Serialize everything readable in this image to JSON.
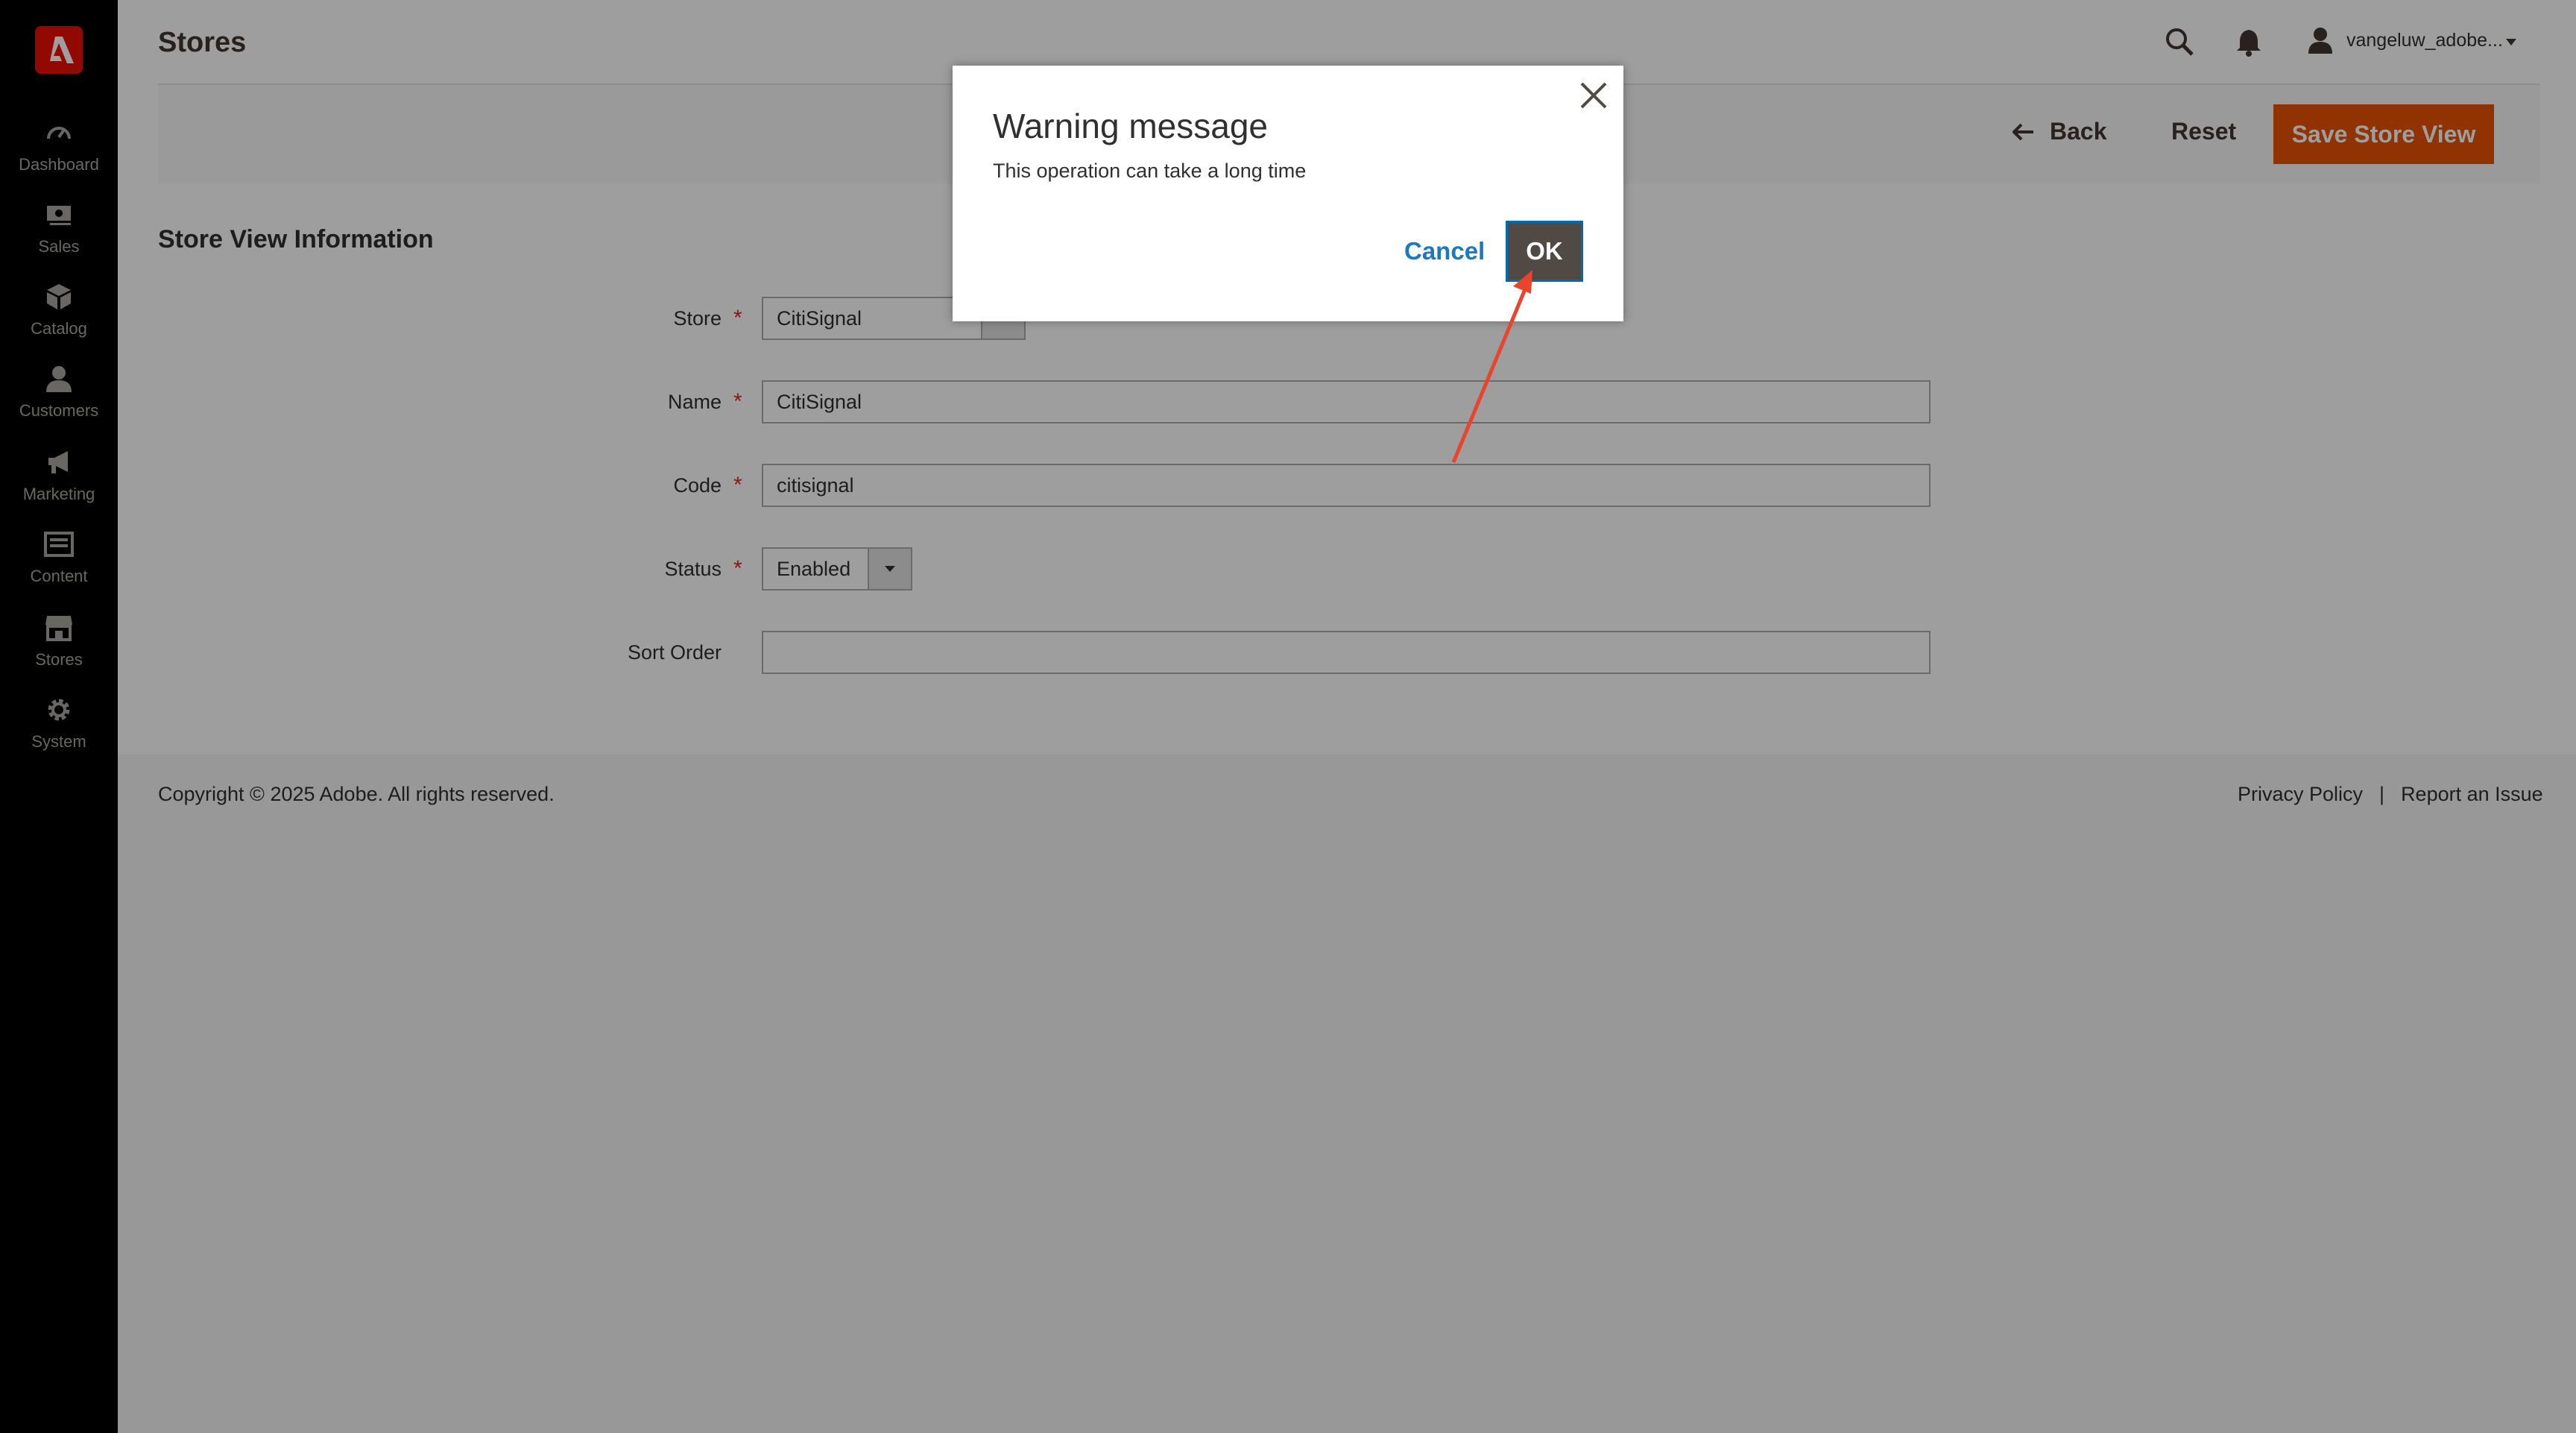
{
  "sidebar": {
    "items": [
      {
        "label": "Dashboard",
        "icon": "dashboard-icon"
      },
      {
        "label": "Sales",
        "icon": "sales-icon"
      },
      {
        "label": "Catalog",
        "icon": "catalog-icon"
      },
      {
        "label": "Customers",
        "icon": "customers-icon"
      },
      {
        "label": "Marketing",
        "icon": "marketing-icon"
      },
      {
        "label": "Content",
        "icon": "content-icon"
      },
      {
        "label": "Stores",
        "icon": "stores-icon"
      },
      {
        "label": "System",
        "icon": "system-icon"
      }
    ]
  },
  "header": {
    "title": "Stores",
    "user": "vangeluw_adobe..."
  },
  "actions": {
    "back": "Back",
    "reset": "Reset",
    "save": "Save Store View"
  },
  "form": {
    "section_title": "Store View Information",
    "store_label": "Store",
    "store_value": "CitiSignal",
    "name_label": "Name",
    "name_value": "CitiSignal",
    "code_label": "Code",
    "code_value": "citisignal",
    "status_label": "Status",
    "status_value": "Enabled",
    "sort_label": "Sort Order",
    "sort_value": "",
    "required_mark": "*"
  },
  "footer": {
    "copyright": "Copyright © 2025 Adobe. All rights reserved.",
    "privacy": "Privacy Policy",
    "separator": "|",
    "report": "Report an Issue"
  },
  "modal": {
    "title": "Warning message",
    "text": "This operation can take a long time",
    "cancel": "Cancel",
    "ok": "OK"
  },
  "colors": {
    "accent": "#eb5202",
    "link": "#1979c3",
    "annotation_arrow": "#e8452c"
  }
}
